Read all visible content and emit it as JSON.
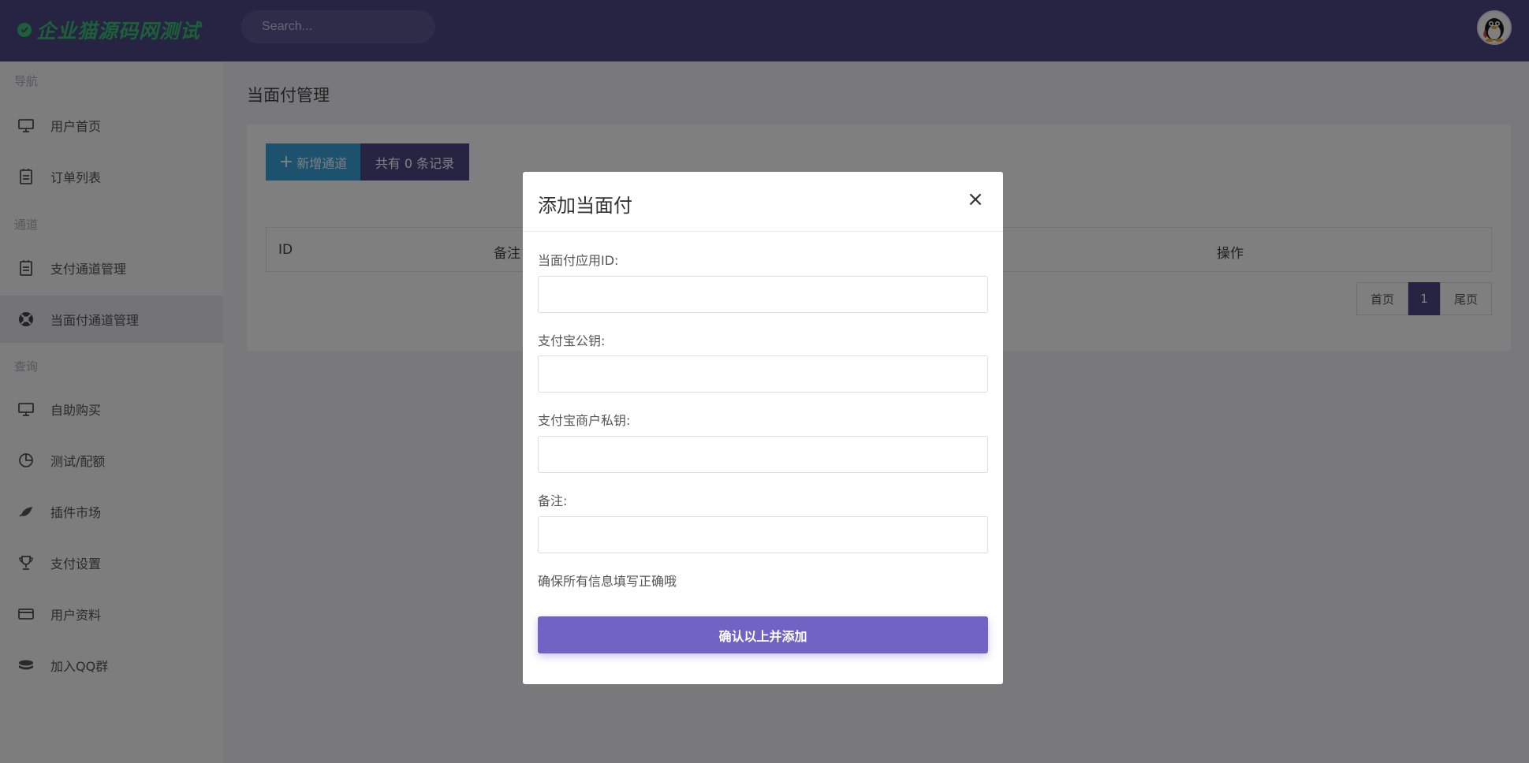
{
  "header": {
    "brand": "企业猫源码网测试",
    "search_placeholder": "Search..."
  },
  "sidebar": {
    "sections": [
      {
        "heading": "导航",
        "items": [
          {
            "label": "用户首页",
            "icon": "monitor-icon"
          },
          {
            "label": "订单列表",
            "icon": "clipboard-icon"
          }
        ]
      },
      {
        "heading": "通道",
        "items": [
          {
            "label": "支付通道管理",
            "icon": "clipboard-icon"
          },
          {
            "label": "当面付通道管理",
            "icon": "lifebuoy-icon",
            "active": true
          }
        ]
      },
      {
        "heading": "查询",
        "items": [
          {
            "label": "自助购买",
            "icon": "monitor-icon"
          },
          {
            "label": "测试/配额",
            "icon": "pie-chart-icon"
          },
          {
            "label": "插件市场",
            "icon": "leaf-icon"
          },
          {
            "label": "支付设置",
            "icon": "trophy-icon"
          },
          {
            "label": "用户资料",
            "icon": "credit-card-icon"
          },
          {
            "label": "加入QQ群",
            "icon": "database-icon"
          }
        ]
      }
    ]
  },
  "main": {
    "title": "当面付管理",
    "new_button": "新增通道",
    "count_label": "共有 0 条记录",
    "table": {
      "columns": [
        "ID",
        "备注",
        "操作"
      ]
    },
    "pagination": {
      "first": "首页",
      "current": "1",
      "last": "尾页"
    }
  },
  "modal": {
    "title": "添加当面付",
    "fields": [
      {
        "label": "当面付应用ID:",
        "value": ""
      },
      {
        "label": "支付宝公钥:",
        "value": ""
      },
      {
        "label": "支付宝商户私钥:",
        "value": ""
      },
      {
        "label": "备注:",
        "value": ""
      }
    ],
    "hint": "确保所有信息填写正确哦",
    "submit": "确认以上并添加"
  },
  "colors": {
    "header_bg": "#4e4685",
    "brand_green": "#38c172",
    "accent_blue": "#39a5dd",
    "submit_purple": "#6f63c4"
  }
}
